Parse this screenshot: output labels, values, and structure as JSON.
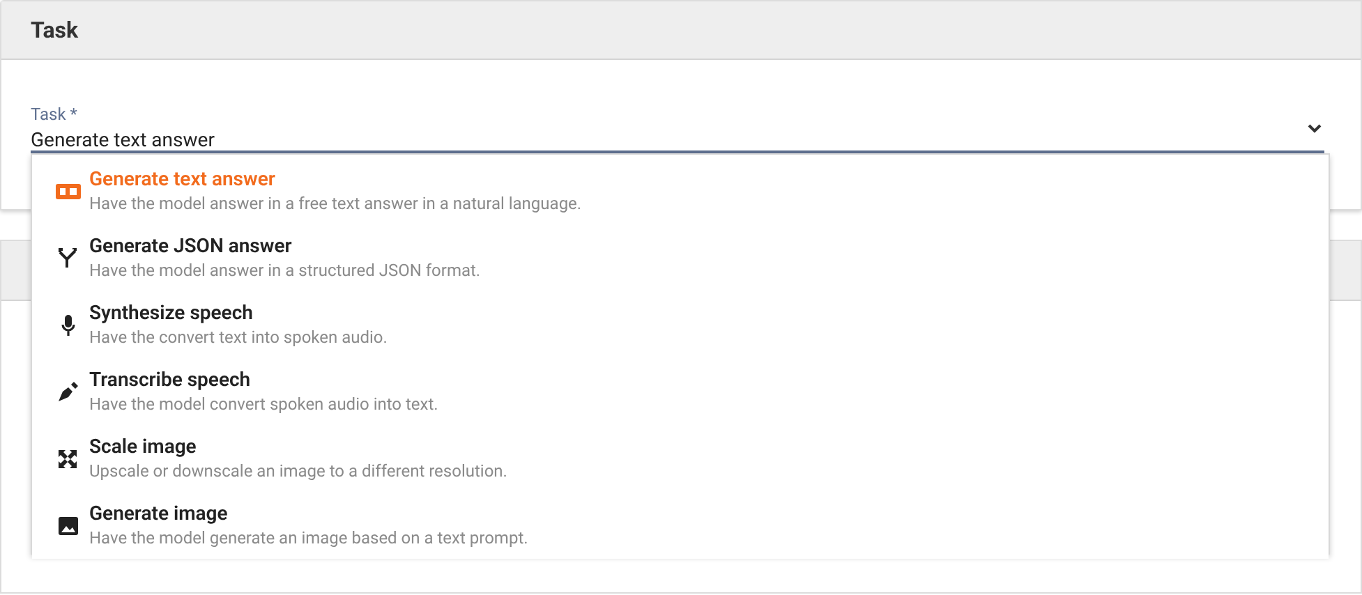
{
  "card": {
    "title": "Task"
  },
  "task_field": {
    "label": "Task *",
    "value": "Generate text answer",
    "expanded": true
  },
  "menu": [
    {
      "kind": "text",
      "title": "Generate text answer",
      "description": "Have the model answer in a free text answer in a natural language.",
      "selected": true
    },
    {
      "kind": "json",
      "title": "Generate JSON answer",
      "description": "Have the model answer in a structured JSON format.",
      "selected": false
    },
    {
      "kind": "mic",
      "title": "Synthesize speech",
      "description": "Have the convert text into spoken audio.",
      "selected": false
    },
    {
      "kind": "pen",
      "title": "Transcribe speech",
      "description": "Have the model convert spoken audio into text.",
      "selected": false
    },
    {
      "kind": "scale",
      "title": "Scale image",
      "description": "Upscale or downscale an image to a different resolution.",
      "selected": false
    },
    {
      "kind": "image",
      "title": "Generate image",
      "description": "Have the model generate an image based on a text prompt.",
      "selected": false
    }
  ]
}
